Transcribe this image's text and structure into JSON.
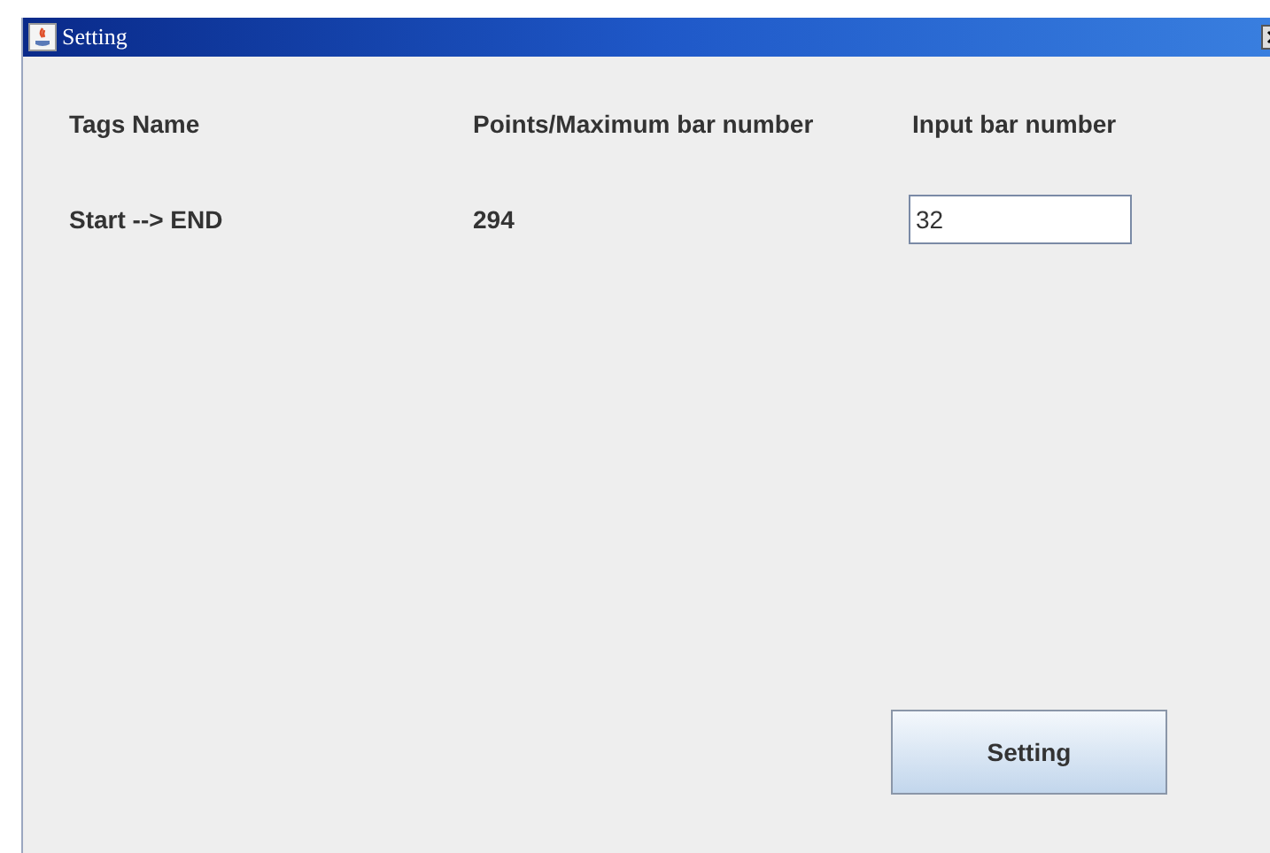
{
  "window": {
    "title": "Setting"
  },
  "columns": [
    "Tags Name",
    "Points/Maximum bar number",
    "Input bar number"
  ],
  "rows": [
    {
      "tags_name": "Start --> END",
      "points": "294",
      "input_value": "32"
    }
  ],
  "button": {
    "label": "Setting"
  }
}
